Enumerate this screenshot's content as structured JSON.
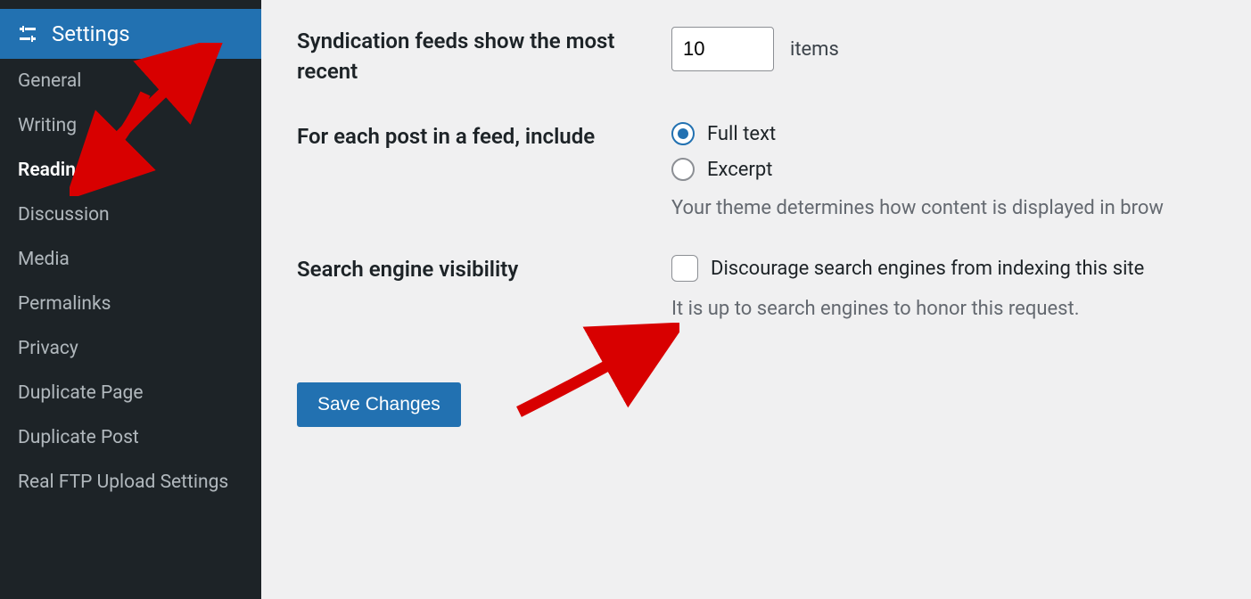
{
  "sidebar": {
    "header": "Settings",
    "items": [
      {
        "label": "General",
        "active": false
      },
      {
        "label": "Writing",
        "active": false
      },
      {
        "label": "Reading",
        "active": true
      },
      {
        "label": "Discussion",
        "active": false
      },
      {
        "label": "Media",
        "active": false
      },
      {
        "label": "Permalinks",
        "active": false
      },
      {
        "label": "Privacy",
        "active": false
      },
      {
        "label": "Duplicate Page",
        "active": false
      },
      {
        "label": "Duplicate Post",
        "active": false
      },
      {
        "label": "Real FTP Upload Settings",
        "active": false
      }
    ]
  },
  "form": {
    "syndication": {
      "label": "Syndication feeds show the most recent",
      "value": "10",
      "unit": "items"
    },
    "feed_include": {
      "label": "For each post in a feed, include",
      "options": [
        {
          "label": "Full text",
          "checked": true
        },
        {
          "label": "Excerpt",
          "checked": false
        }
      ],
      "description": "Your theme determines how content is displayed in brow"
    },
    "search_visibility": {
      "label": "Search engine visibility",
      "checkbox_label": "Discourage search engines from indexing this site",
      "checked": false,
      "description": "It is up to search engines to honor this request."
    },
    "save_button": "Save Changes"
  }
}
